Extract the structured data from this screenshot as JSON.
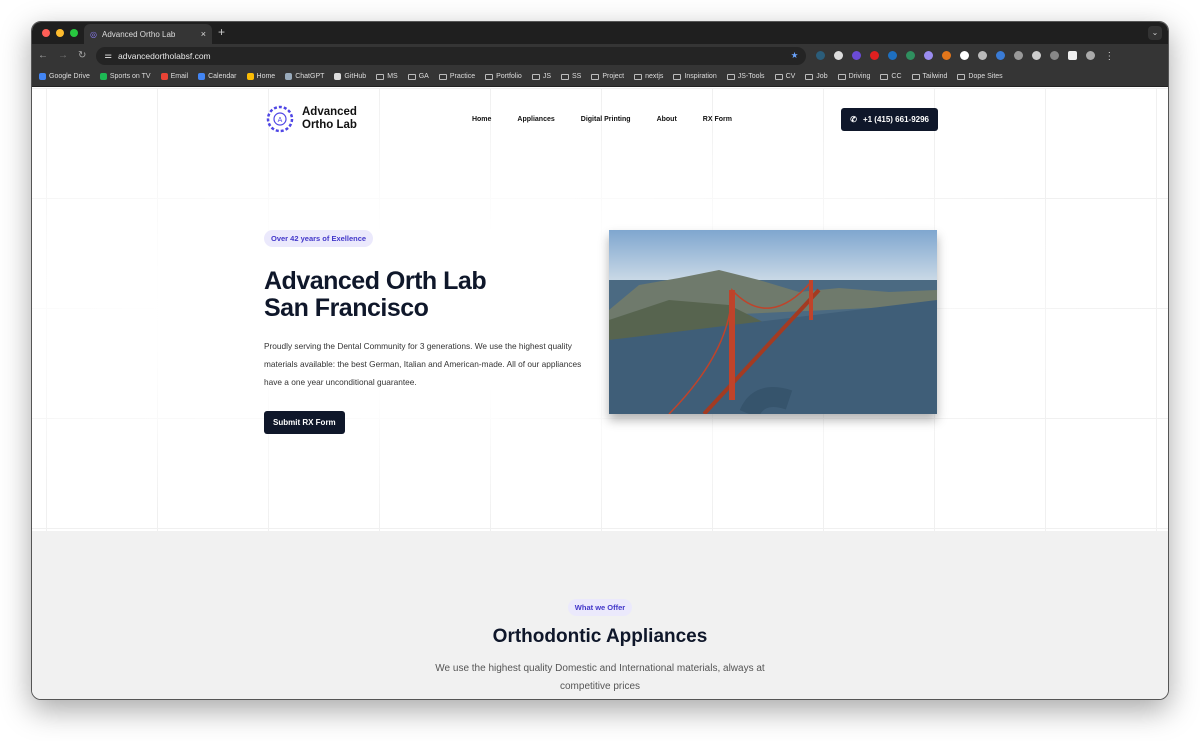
{
  "browser": {
    "tab_title": "Advanced Ortho Lab",
    "url": "advancedortholabsf.com",
    "bookmarks": [
      "Google Drive",
      "Sports on TV",
      "Email",
      "Calendar",
      "Home",
      "ChatGPT",
      "GitHub",
      "MS",
      "GA",
      "Practice",
      "Portfolio",
      "JS",
      "SS",
      "Project",
      "nextjs",
      "Inspiration",
      "JS-Tools",
      "CV",
      "Job",
      "Driving",
      "CC",
      "Tailwind",
      "Dope Sites"
    ]
  },
  "nav": {
    "logo_line1": "Advanced",
    "logo_line2": "Ortho Lab",
    "logo_ring_text": "AOL+AOL+AOL+",
    "items": [
      "Home",
      "Appliances",
      "Digital Printing",
      "About",
      "RX Form"
    ],
    "phone": "+1 (415) 661-9296"
  },
  "hero": {
    "badge": "Over 42 years of Exellence",
    "title_line1": "Advanced Orth Lab",
    "title_line2": "San Francisco",
    "description": "Proudly serving the Dental Community for 3 generations. We use the highest quality materials available: the best German, Italian and American-made. All of our appliances have a one year unconditional guarantee.",
    "cta": "Submit RX Form"
  },
  "offer": {
    "badge": "What we Offer",
    "title": "Orthodontic Appliances",
    "description": "We use the highest quality Domestic and International materials, always at competitive prices"
  },
  "colors": {
    "accent": "#4338ca",
    "dark": "#0f172a"
  }
}
